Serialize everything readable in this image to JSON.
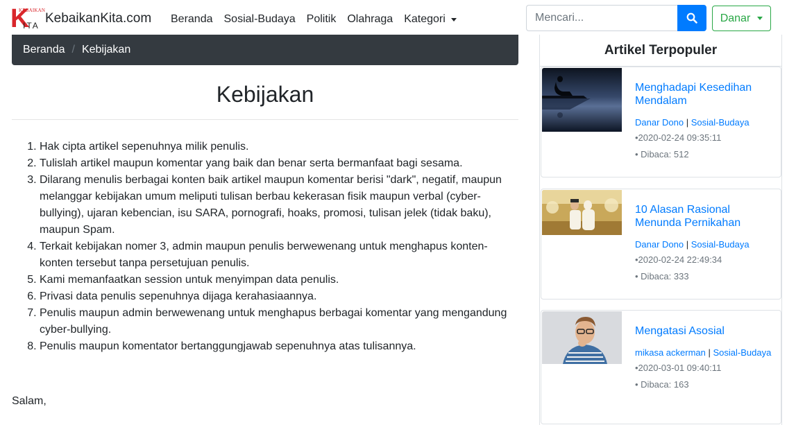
{
  "brand": {
    "logo_top": "KEBAIKAN",
    "logo_k": "K",
    "logo_ita": "ITA",
    "name": "KebaikanKita.com"
  },
  "nav": [
    "Beranda",
    "Sosial-Budaya",
    "Politik",
    "Olahraga",
    "Kategori"
  ],
  "search": {
    "placeholder": "Mencari..."
  },
  "user": {
    "name": "Danar"
  },
  "breadcrumb": [
    "Beranda",
    "Kebijakan"
  ],
  "page": {
    "title": "Kebijakan",
    "items": [
      "Hak cipta artikel sepenuhnya milik penulis.",
      "Tulislah artikel maupun komentar yang baik dan benar serta bermanfaat bagi sesama.",
      "Dilarang menulis berbagai konten baik artikel maupun komentar berisi \"dark\", negatif, maupun melanggar kebijakan umum meliputi tulisan berbau kekerasan fisik maupun verbal (cyber-bullying), ujaran kebencian, isu SARA, pornografi, hoaks, promosi, tulisan jelek (tidak baku), maupun Spam.",
      "Terkait kebijakan nomer 3, admin maupun penulis berwewenang untuk menghapus konten-konten tersebut tanpa persetujuan penulis.",
      "Kami memanfaatkan session untuk menyimpan data penulis.",
      "Privasi data penulis sepenuhnya dijaga kerahasiaannya.",
      "Penulis maupun admin berwewenang untuk menghapus berbagai komentar yang mengandung cyber-bullying.",
      "Penulis maupun komentator bertanggungjawab sepenuhnya atas tulisannya."
    ],
    "closing": "Salam,"
  },
  "sidebar": {
    "title": "Artikel Terpopuler",
    "articles": [
      {
        "title": "Menghadapi Kesedihan Mendalam",
        "author": "Danar Dono",
        "separator": "|",
        "category": "Sosial-Budaya",
        "date": "•2020-02-24 09:35:11",
        "reads": "• Dibaca: 512"
      },
      {
        "title": "10 Alasan Rasional Menunda Pernikahan",
        "author": "Danar Dono",
        "separator": "|",
        "category": "Sosial-Budaya",
        "date": "•2020-02-24 22:49:34",
        "reads": "• Dibaca: 333"
      },
      {
        "title": "Mengatasi Asosial",
        "author": "mikasa ackerman",
        "separator": "|",
        "category": "Sosial-Budaya",
        "date": "•2020-03-01 09:40:11",
        "reads": "• Dibaca: 163"
      }
    ]
  },
  "colors": {
    "primary": "#007bff",
    "success": "#28a745",
    "dark": "#343a40",
    "logo_red": "#d9262b"
  }
}
